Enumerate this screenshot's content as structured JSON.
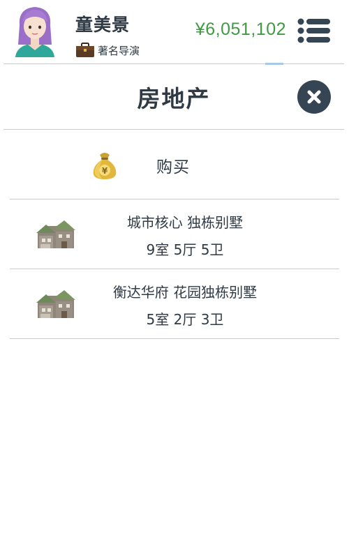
{
  "header": {
    "user_name": "童美景",
    "job_title": "著名导演",
    "money": "¥6,051,102",
    "icons": {
      "avatar": "avatar-girl-purple-hair",
      "job": "briefcase-icon",
      "menu": "list-menu-icon"
    }
  },
  "page": {
    "title": "房地产",
    "close_icon": "close-icon"
  },
  "buy": {
    "label": "购买",
    "icon": "money-bag-icon"
  },
  "properties": [
    {
      "name": "城市核心 独栋别墅",
      "layout": "9室 5厅 5卫",
      "icon": "house-icon"
    },
    {
      "name": "衡达华府 花园独栋别墅",
      "layout": "5室 2厅 3卫",
      "icon": "house-icon"
    }
  ],
  "colors": {
    "text": "#2f3a44",
    "money": "#3f9a41",
    "close_bg": "#354554",
    "divider": "#c9cccf"
  }
}
